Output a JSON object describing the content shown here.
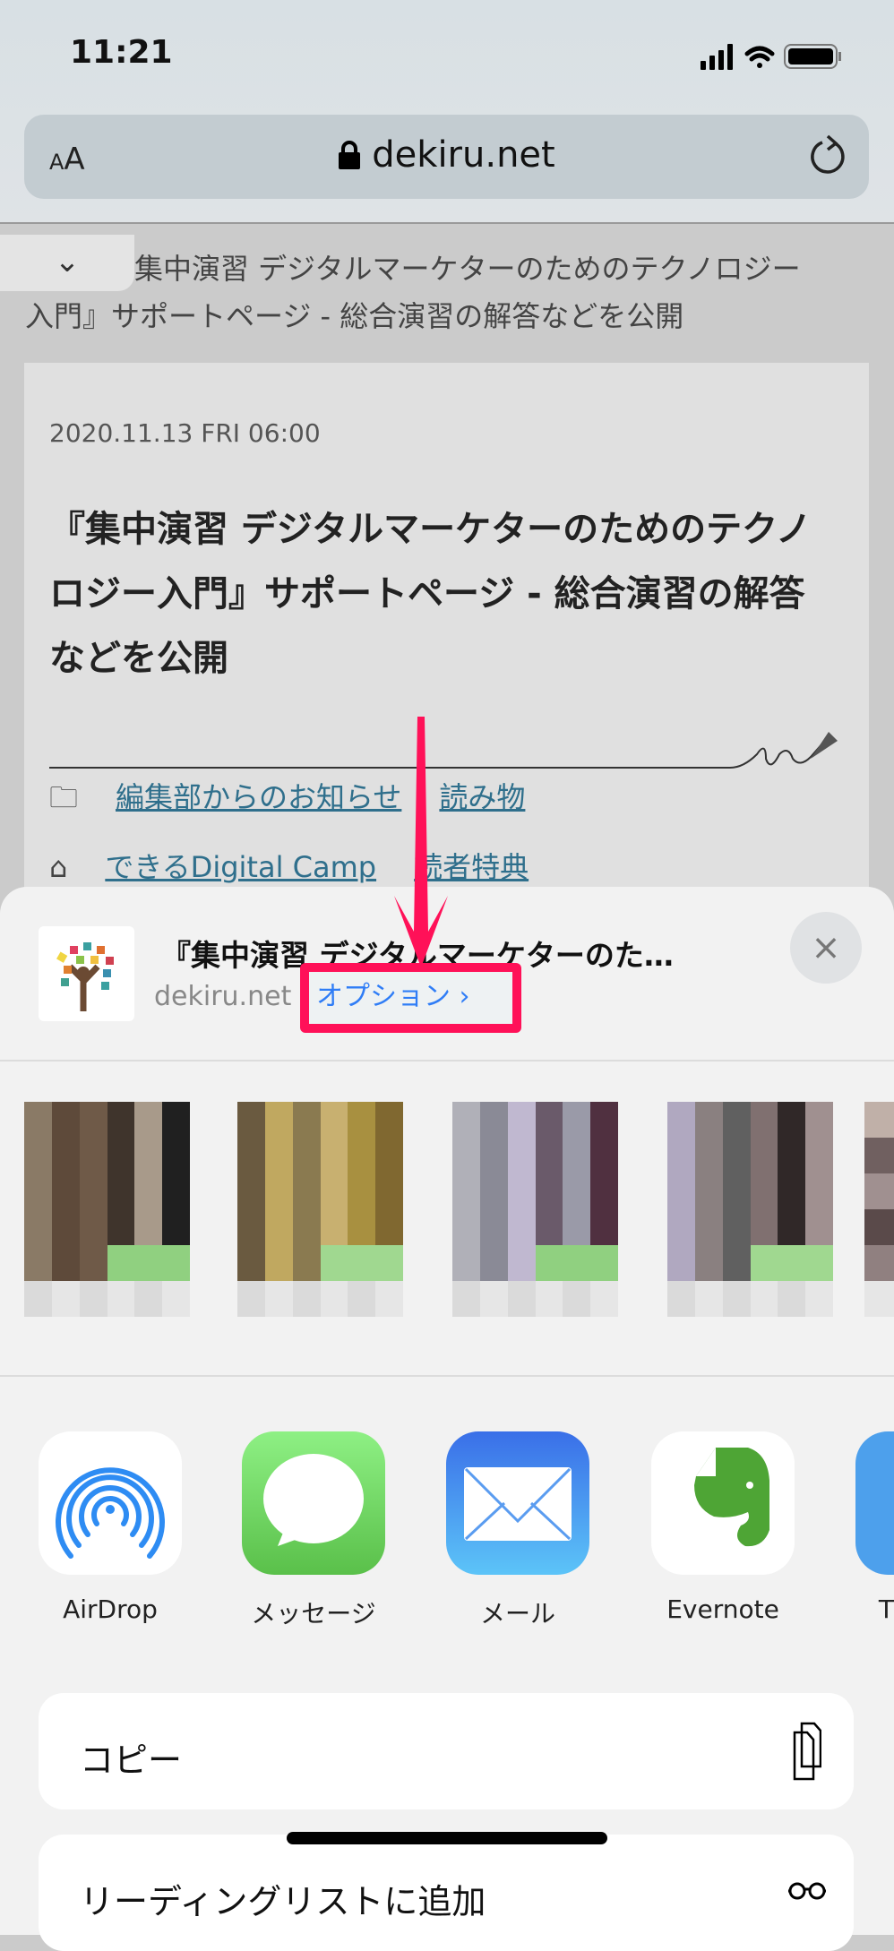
{
  "status_bar": {
    "time": "11:21"
  },
  "browser": {
    "text_size_label_small": "A",
    "text_size_label": "A",
    "url": "dekiru.net"
  },
  "page": {
    "header_line1": "集中演習 デジタルマーケターのためのテクノロジー",
    "header_line2": "入門』サポートページ - 総合演習の解答などを公開",
    "article": {
      "date": "2020.11.13 FRI 06:00",
      "title": "『集中演習 デジタルマーケターのためのテクノロジー入門』サポートページ - 総合演習の解答などを公開",
      "categories": [
        "編集部からのお知らせ",
        "読み物"
      ],
      "tags": [
        "できるDigital Camp",
        "読者特典"
      ]
    }
  },
  "share_sheet": {
    "title": "『集中演習 デジタルマーケターのた…",
    "domain": "dekiru.net",
    "options_label": "オプション ›",
    "close_icon": "×",
    "apps": [
      {
        "label": "AirDrop",
        "icon": "airdrop-icon"
      },
      {
        "label": "メッセージ",
        "icon": "messages-icon"
      },
      {
        "label": "メール",
        "icon": "mail-icon"
      },
      {
        "label": "Evernote",
        "icon": "evernote-icon"
      },
      {
        "label": "T",
        "icon": "twitter-icon"
      }
    ],
    "actions": [
      {
        "label": "コピー",
        "icon": "copy-icon"
      },
      {
        "label": "リーディングリストに追加",
        "icon": "glasses-icon"
      }
    ]
  },
  "annotation": {
    "color": "#ff1158"
  }
}
